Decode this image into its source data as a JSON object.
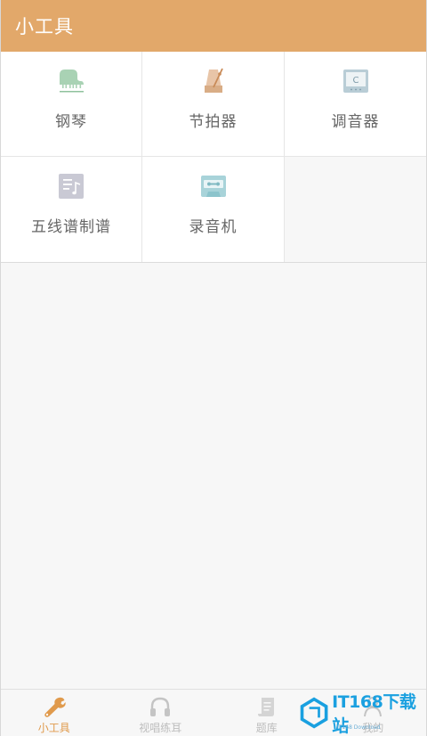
{
  "header": {
    "title": "小工具"
  },
  "tools": [
    {
      "label": "钢琴",
      "icon": "piano-icon"
    },
    {
      "label": "节拍器",
      "icon": "metronome-icon"
    },
    {
      "label": "调音器",
      "icon": "tuner-icon"
    },
    {
      "label": "五线谱制谱",
      "icon": "sheet-music-icon"
    },
    {
      "label": "录音机",
      "icon": "cassette-recorder-icon"
    }
  ],
  "tabbar": {
    "active": "小工具",
    "items": [
      {
        "label": "小工具",
        "icon": "wrench-icon"
      },
      {
        "label": "视唱练耳",
        "icon": "headphones-icon"
      },
      {
        "label": "题库",
        "icon": "scroll-icon"
      },
      {
        "label": "我的",
        "icon": "user-icon"
      }
    ]
  },
  "watermark": {
    "text": "IT168下载站",
    "subtext": "IT168 Download"
  },
  "colors": {
    "header": "#e2a86a",
    "active_tab": "#e09a4c",
    "inactive_tab": "#bdbdbd"
  }
}
